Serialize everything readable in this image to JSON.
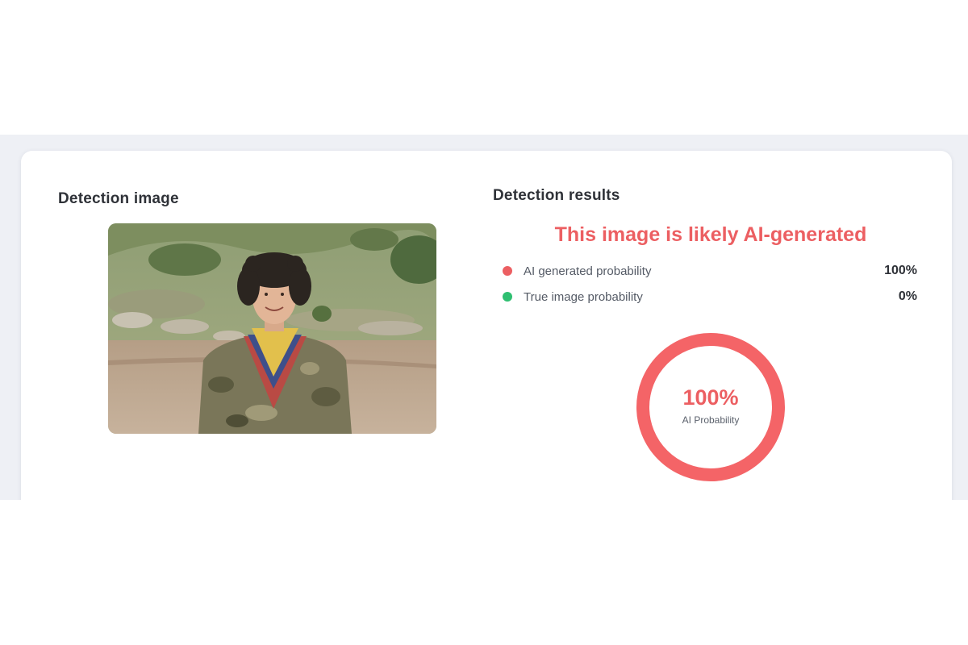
{
  "detection_image": {
    "title": "Detection image"
  },
  "results": {
    "title": "Detection results",
    "verdict": "This image is likely AI-generated",
    "rows": [
      {
        "label": "AI generated probability",
        "value": "100%",
        "color": "#ec5f62"
      },
      {
        "label": "True image probability",
        "value": "0%",
        "color": "#2fbf71"
      }
    ],
    "gauge": {
      "value": "100%",
      "caption": "AI Probability",
      "fraction": 1.0,
      "color": "#f46467"
    }
  },
  "colors": {
    "accent_red": "#ec5f62",
    "accent_green": "#2fbf71",
    "backdrop": "#eef0f5"
  }
}
